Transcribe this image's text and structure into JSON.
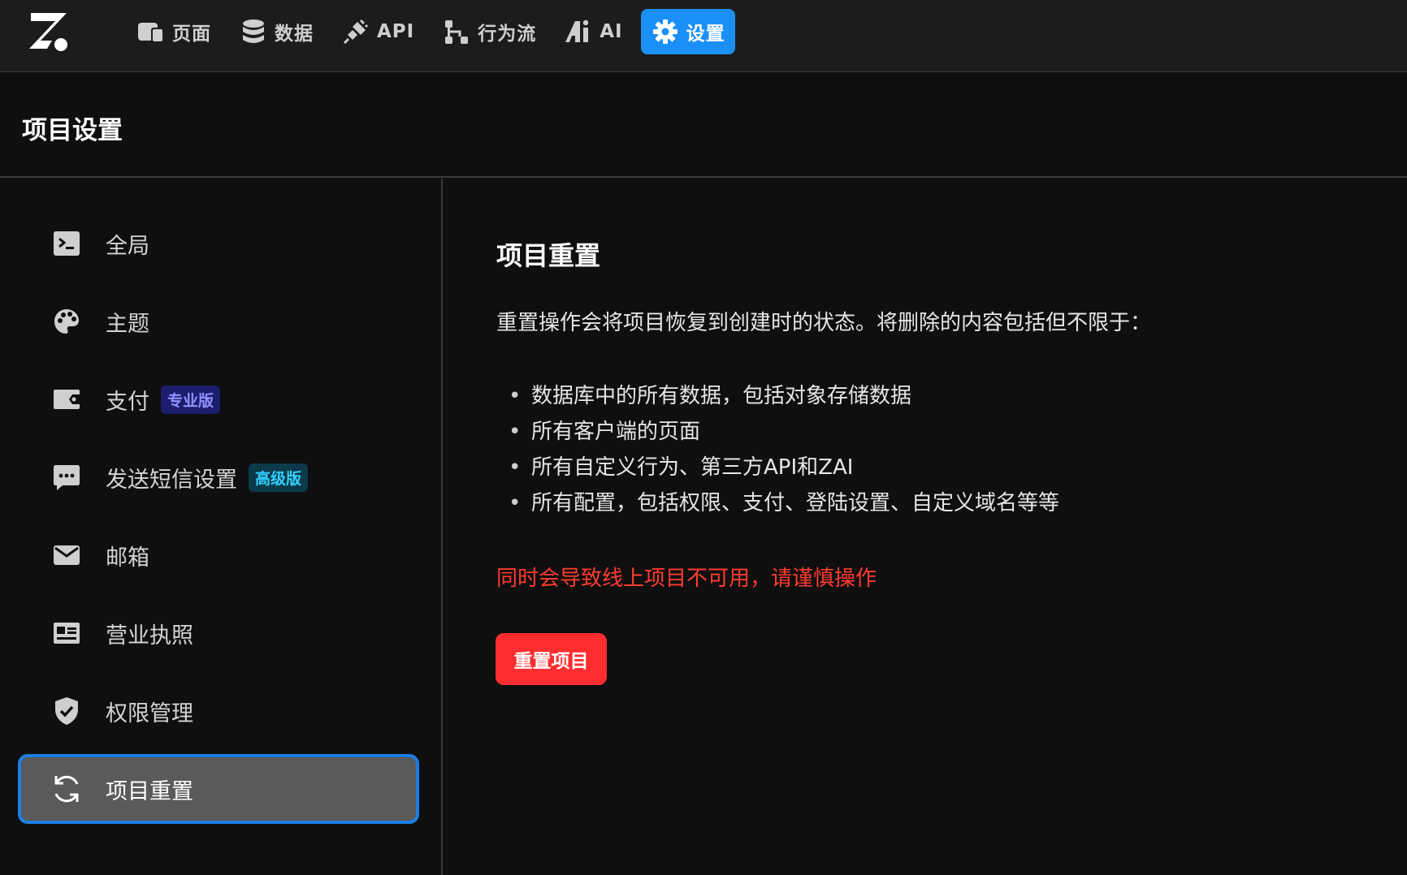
{
  "nav": {
    "items": [
      {
        "label": "页面",
        "icon": "pages-icon"
      },
      {
        "label": "数据",
        "icon": "database-icon"
      },
      {
        "label": "API",
        "icon": "plug-icon"
      },
      {
        "label": "行为流",
        "icon": "flow-icon"
      },
      {
        "label": "AI",
        "icon": "ai-icon"
      },
      {
        "label": "设置",
        "icon": "gear-icon",
        "active": true
      }
    ]
  },
  "header": {
    "title": "项目设置"
  },
  "sidebar": {
    "items": [
      {
        "label": "全局",
        "icon": "terminal-icon"
      },
      {
        "label": "主题",
        "icon": "palette-icon"
      },
      {
        "label": "支付",
        "icon": "wallet-icon",
        "badge": "专业版"
      },
      {
        "label": "发送短信设置",
        "icon": "sms-icon",
        "badge": "高级版"
      },
      {
        "label": "邮箱",
        "icon": "mail-icon"
      },
      {
        "label": "营业执照",
        "icon": "license-icon"
      },
      {
        "label": "权限管理",
        "icon": "shield-icon"
      },
      {
        "label": "项目重置",
        "icon": "refresh-icon",
        "active": true
      }
    ]
  },
  "content": {
    "title": "项目重置",
    "description": "重置操作会将项目恢复到创建时的状态。将删除的内容包括但不限于：",
    "bullets": [
      "数据库中的所有数据，包括对象存储数据",
      "所有客户端的页面",
      "所有自定义行为、第三方API和ZAI",
      "所有配置，包括权限、支付、登陆设置、自定义域名等等"
    ],
    "warning": "同时会导致线上项目不可用，请谨慎操作",
    "button_label": "重置项目"
  },
  "colors": {
    "accent": "#1a8ff7",
    "danger": "#ff2d2d",
    "warning_text": "#ff3b30",
    "badge_pro": "#8f93ff",
    "badge_advanced": "#33d0ff"
  }
}
